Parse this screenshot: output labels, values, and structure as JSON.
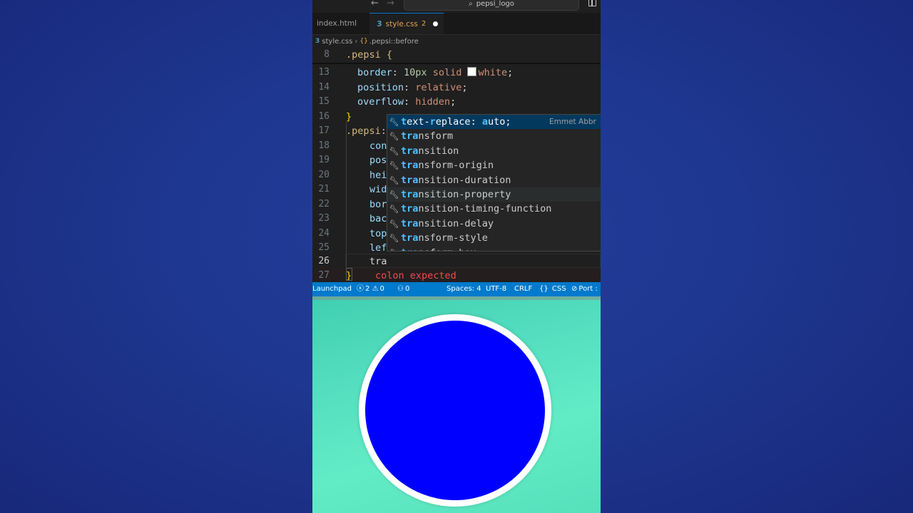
{
  "titlebar": {
    "back": "←",
    "forward": "→",
    "search_text": "pepsi_logo"
  },
  "tabs": [
    {
      "label": "index.html"
    },
    {
      "label": "style.css",
      "problems": "2"
    }
  ],
  "breadcrumb": {
    "file": "style.css",
    "symbol": ".pepsi::before"
  },
  "sticky": {
    "line": "8",
    "text": ".pepsi {"
  },
  "editor_lines": [
    {
      "n": "13",
      "prop": "border",
      "rest_num": "10px",
      "rest": " solid ",
      "value": "white",
      "end": ";"
    },
    {
      "n": "14",
      "prop": "position",
      "value": "relative"
    },
    {
      "n": "15",
      "prop": "overflow",
      "value": "hidden"
    },
    {
      "n": "16",
      "text": "}"
    },
    {
      "n": "17",
      "text": ".pepsi:"
    },
    {
      "n": "18",
      "text": "con"
    },
    {
      "n": "19",
      "text": "pos"
    },
    {
      "n": "20",
      "text": "hei"
    },
    {
      "n": "21",
      "text": "wid"
    },
    {
      "n": "22",
      "text": "bor"
    },
    {
      "n": "23",
      "text": "bac"
    },
    {
      "n": "24",
      "text": "top"
    },
    {
      "n": "25",
      "text": "lef"
    },
    {
      "n": "26",
      "text": "tra"
    },
    {
      "n": "27",
      "text": "}"
    }
  ],
  "diagnostic": "colon expected",
  "suggestions": [
    {
      "match": "t",
      "mid": "ext-",
      "match2": "r",
      "rest": "eplace: ",
      "match3": "a",
      "rest2": "uto;",
      "detail": "Emmet Abbr"
    },
    {
      "match": "tra",
      "rest": "nsform"
    },
    {
      "match": "tra",
      "rest": "nsition"
    },
    {
      "match": "tra",
      "rest": "nsform-origin"
    },
    {
      "match": "tra",
      "rest": "nsition-duration"
    },
    {
      "match": "tra",
      "rest": "nsition-property"
    },
    {
      "match": "tra",
      "rest": "nsition-timing-function"
    },
    {
      "match": "tra",
      "rest": "nsition-delay"
    },
    {
      "match": "tra",
      "rest": "nsform-style"
    },
    {
      "match": "tra",
      "rest": "nsform-box"
    }
  ],
  "statusbar": {
    "launchpad": "Launchpad",
    "errors": "2",
    "warnings": "0",
    "ports": "0",
    "spaces": "Spaces: 4",
    "encoding": "UTF-8",
    "eol": "CRLF",
    "language": "CSS",
    "port": "Port :"
  },
  "colors": {
    "accent": "#007acc",
    "logo_fill": "#0000ff",
    "logo_border": "#ffffff",
    "preview_bg": "#55dfc0"
  }
}
